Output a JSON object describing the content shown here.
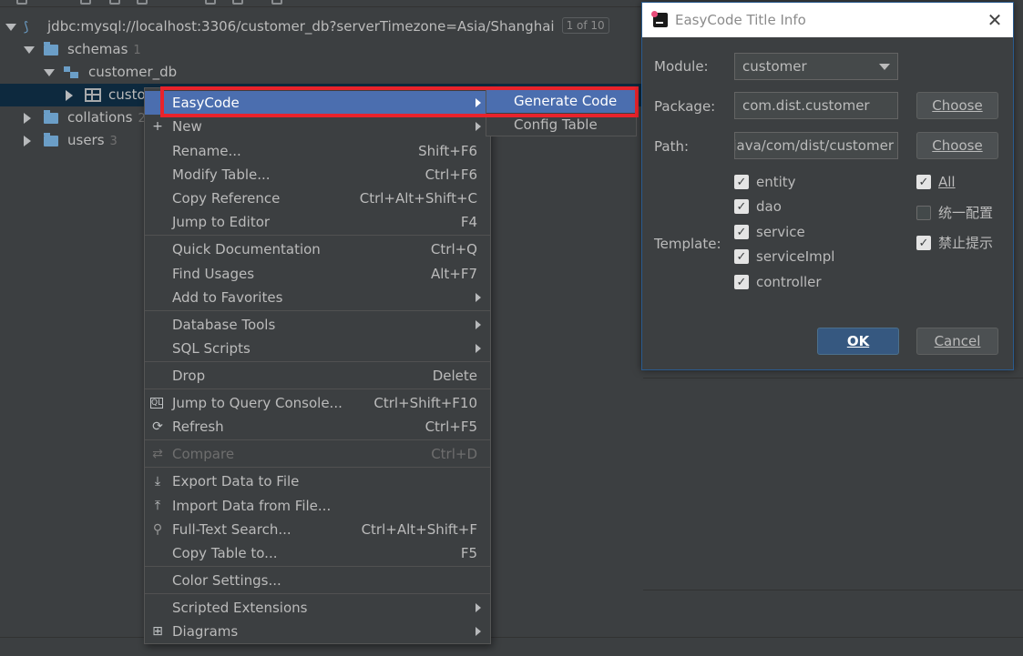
{
  "tree": {
    "connection": "jdbc:mysql://localhost:3306/customer_db?serverTimezone=Asia/Shanghai",
    "connection_badge": "1 of 10",
    "schemas_label": "schemas",
    "schemas_count": "1",
    "db_label": "customer_db",
    "table_label": "custo",
    "collations_label": "collations",
    "collations_count": "2",
    "users_label": "users",
    "users_count": "3"
  },
  "context_menu": {
    "items": [
      {
        "label": "EasyCode",
        "shortcut": "",
        "submenu": true
      },
      {
        "label": "New",
        "shortcut": "",
        "submenu": true
      },
      {
        "label": "Rename...",
        "shortcut": "Shift+F6"
      },
      {
        "label": "Modify Table...",
        "shortcut": "Ctrl+F6"
      },
      {
        "label": "Copy Reference",
        "shortcut": "Ctrl+Alt+Shift+C"
      },
      {
        "label": "Jump to Editor",
        "shortcut": "F4"
      },
      {
        "label": "Quick Documentation",
        "shortcut": "Ctrl+Q"
      },
      {
        "label": "Find Usages",
        "shortcut": "Alt+F7"
      },
      {
        "label": "Add to Favorites",
        "shortcut": "",
        "submenu": true
      },
      {
        "label": "Database Tools",
        "shortcut": "",
        "submenu": true
      },
      {
        "label": "SQL Scripts",
        "shortcut": "",
        "submenu": true
      },
      {
        "label": "Drop",
        "shortcut": "Delete"
      },
      {
        "label": "Jump to Query Console...",
        "shortcut": "Ctrl+Shift+F10"
      },
      {
        "label": "Refresh",
        "shortcut": "Ctrl+F5"
      },
      {
        "label": "Compare",
        "shortcut": "Ctrl+D",
        "disabled": true
      },
      {
        "label": "Export Data to File",
        "shortcut": ""
      },
      {
        "label": "Import Data from File...",
        "shortcut": ""
      },
      {
        "label": "Full-Text Search...",
        "shortcut": "Ctrl+Alt+Shift+F"
      },
      {
        "label": "Copy Table to...",
        "shortcut": "F5"
      },
      {
        "label": "Color Settings...",
        "shortcut": ""
      },
      {
        "label": "Scripted Extensions",
        "shortcut": "",
        "submenu": true
      },
      {
        "label": "Diagrams",
        "shortcut": "",
        "submenu": true
      }
    ]
  },
  "easycode_submenu": {
    "items": [
      "Generate Code",
      "Config Table"
    ]
  },
  "dialog": {
    "title": "EasyCode Title Info",
    "module_label": "Module:",
    "module_value": "customer",
    "package_label": "Package:",
    "package_value": "com.dist.customer",
    "path_label": "Path:",
    "path_value": "java/com/dist/customer",
    "choose_label": "Choose",
    "template_label": "Template:",
    "templates": [
      {
        "label": "entity",
        "checked": true
      },
      {
        "label": "dao",
        "checked": true
      },
      {
        "label": "service",
        "checked": true
      },
      {
        "label": "serviceImpl",
        "checked": true
      },
      {
        "label": "controller",
        "checked": true
      }
    ],
    "options": [
      {
        "label": "All",
        "checked": true
      },
      {
        "label": "统一配置",
        "checked": false
      },
      {
        "label": "禁止提示",
        "checked": true
      }
    ],
    "ok_label": "OK",
    "cancel_label": "Cancel"
  },
  "colors": {
    "accent": "#4b6eaf",
    "highlight_border": "#e8232b",
    "background": "#3c3f41"
  }
}
